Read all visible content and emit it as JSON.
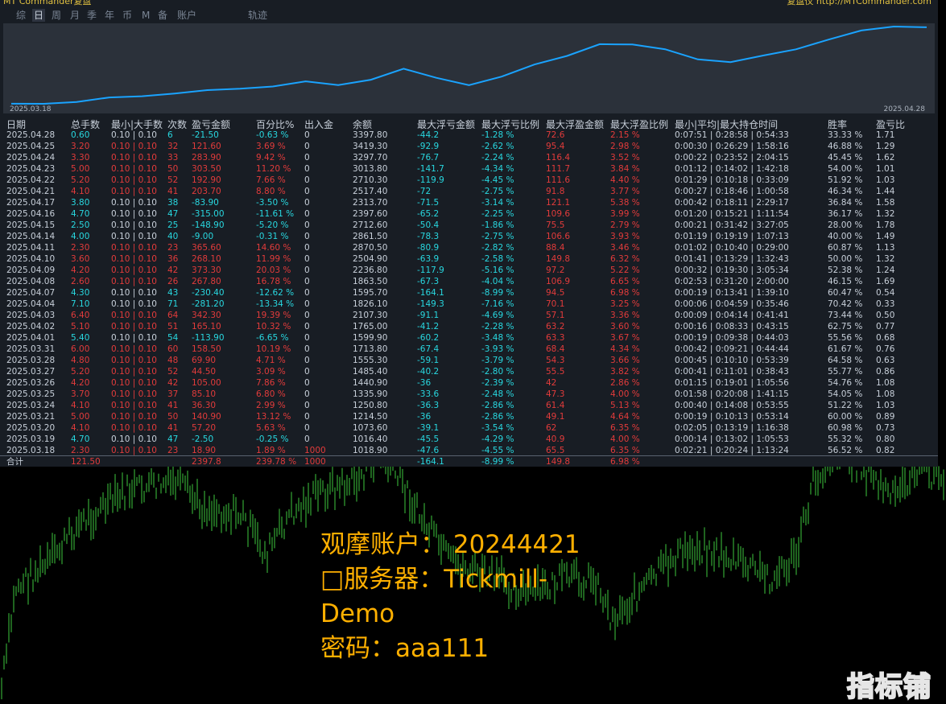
{
  "app": {
    "title_left": "MT Commander复盘",
    "title_right": "复盘仪 http://MTCommander.com"
  },
  "tabs": [
    "综",
    "日",
    "周",
    "月",
    "季",
    "年",
    "币",
    "M",
    "备",
    "账户",
    "轨迹"
  ],
  "active_tab": "日",
  "equity_chart": {
    "start_date": "2025.03.18",
    "end_date": "2025.04.28",
    "line_color": "#1aa3ff",
    "values": [
      1018.9,
      1016.4,
      1073.6,
      1214.5,
      1250.8,
      1335.9,
      1440.9,
      1485.4,
      1555.3,
      1713.8,
      1599.9,
      1765.0,
      2107.3,
      1826.1,
      1595.7,
      1863.5,
      2236.8,
      2504.9,
      2870.5,
      2861.5,
      2712.6,
      2397.6,
      2313.7,
      2517.4,
      2710.3,
      3013.8,
      3297.7,
      3419.3,
      3397.8
    ]
  },
  "table": {
    "headers": [
      "日期",
      "总手数",
      "最小|大手数",
      "次数",
      "盈亏金额",
      "百分比%",
      "出入金",
      "余额",
      "最大浮亏金额",
      "最大浮亏比例",
      "最大浮盈金额",
      "最大浮盈比例",
      "最小|平均|最大持仓时间",
      "胜率",
      "盈亏比"
    ],
    "rows": [
      [
        "2025.04.28",
        "0.60",
        "0.10 | 0.10",
        "6",
        "-21.50",
        "-0.63 %",
        "0",
        "3397.80",
        "-44.2",
        "-1.28 %",
        "72.6",
        "2.15 %",
        "0:07:51 | 0:28:58 | 0:54:33",
        "33.33 %",
        "1.71"
      ],
      [
        "2025.04.25",
        "3.20",
        "0.10 | 0.10",
        "32",
        "121.60",
        "3.69 %",
        "0",
        "3419.30",
        "-92.9",
        "-2.62 %",
        "95.4",
        "2.98 %",
        "0:00:30 | 0:26:29 | 1:58:16",
        "46.88 %",
        "1.29"
      ],
      [
        "2025.04.24",
        "3.30",
        "0.10 | 0.10",
        "33",
        "283.90",
        "9.42 %",
        "0",
        "3297.70",
        "-76.7",
        "-2.24 %",
        "116.4",
        "3.52 %",
        "0:00:22 | 0:23:52 | 2:04:15",
        "45.45 %",
        "1.62"
      ],
      [
        "2025.04.23",
        "5.00",
        "0.10 | 0.10",
        "50",
        "303.50",
        "11.20 %",
        "0",
        "3013.80",
        "-141.7",
        "-4.34 %",
        "111.7",
        "3.84 %",
        "0:01:12 | 0:14:02 | 1:42:18",
        "54.00 %",
        "1.01"
      ],
      [
        "2025.04.22",
        "5.20",
        "0.10 | 0.10",
        "52",
        "192.90",
        "7.66 %",
        "0",
        "2710.30",
        "-119.9",
        "-4.45 %",
        "111.6",
        "4.40 %",
        "0:01:29 | 0:10:18 | 0:33:09",
        "51.92 %",
        "1.03"
      ],
      [
        "2025.04.21",
        "4.10",
        "0.10 | 0.10",
        "41",
        "203.70",
        "8.80 %",
        "0",
        "2517.40",
        "-72",
        "-2.75 %",
        "91.8",
        "3.77 %",
        "0:00:27 | 0:18:46 | 1:00:58",
        "46.34 %",
        "1.44"
      ],
      [
        "2025.04.17",
        "3.80",
        "0.10 | 0.10",
        "38",
        "-83.90",
        "-3.50 %",
        "0",
        "2313.70",
        "-71.5",
        "-3.14 %",
        "121.1",
        "5.38 %",
        "0:00:42 | 0:18:11 | 2:29:17",
        "36.84 %",
        "1.58"
      ],
      [
        "2025.04.16",
        "4.70",
        "0.10 | 0.10",
        "47",
        "-315.00",
        "-11.61 %",
        "0",
        "2397.60",
        "-65.2",
        "-2.25 %",
        "109.6",
        "3.99 %",
        "0:01:20 | 0:15:21 | 1:11:54",
        "36.17 %",
        "1.32"
      ],
      [
        "2025.04.15",
        "2.50",
        "0.10 | 0.10",
        "25",
        "-148.90",
        "-5.20 %",
        "0",
        "2712.60",
        "-50.4",
        "-1.86 %",
        "75.5",
        "2.79 %",
        "0:00:21 | 0:31:42 | 3:27:05",
        "28.00 %",
        "1.78"
      ],
      [
        "2025.04.14",
        "4.00",
        "0.10 | 0.10",
        "40",
        "-9.00",
        "-0.31 %",
        "0",
        "2861.50",
        "-78.3",
        "-2.75 %",
        "106.6",
        "3.93 %",
        "0:01:19 | 0:19:19 | 1:07:13",
        "40.00 %",
        "1.49"
      ],
      [
        "2025.04.11",
        "2.30",
        "0.10 | 0.10",
        "23",
        "365.60",
        "14.60 %",
        "0",
        "2870.50",
        "-80.9",
        "-2.82 %",
        "88.4",
        "3.46 %",
        "0:01:02 | 0:10:40 | 0:29:00",
        "60.87 %",
        "1.13"
      ],
      [
        "2025.04.10",
        "3.60",
        "0.10 | 0.10",
        "36",
        "268.10",
        "11.99 %",
        "0",
        "2504.90",
        "-63.9",
        "-2.58 %",
        "149.8",
        "6.32 %",
        "0:01:41 | 0:13:29 | 1:32:43",
        "50.00 %",
        "1.32"
      ],
      [
        "2025.04.09",
        "4.20",
        "0.10 | 0.10",
        "42",
        "373.30",
        "20.03 %",
        "0",
        "2236.80",
        "-117.9",
        "-5.16 %",
        "97.2",
        "5.22 %",
        "0:00:32 | 0:19:30 | 3:05:34",
        "52.38 %",
        "1.24"
      ],
      [
        "2025.04.08",
        "2.60",
        "0.10 | 0.10",
        "26",
        "267.80",
        "16.78 %",
        "0",
        "1863.50",
        "-67.3",
        "-4.04 %",
        "106.9",
        "6.65 %",
        "0:02:53 | 0:31:20 | 2:00:00",
        "46.15 %",
        "1.69"
      ],
      [
        "2025.04.07",
        "4.30",
        "0.10 | 0.10",
        "43",
        "-230.40",
        "-12.62 %",
        "0",
        "1595.70",
        "-164.1",
        "-8.99 %",
        "94.5",
        "6.98 %",
        "0:00:19 | 0:13:41 | 1:39:10",
        "60.47 %",
        "0.54"
      ],
      [
        "2025.04.04",
        "7.10",
        "0.10 | 0.10",
        "71",
        "-281.20",
        "-13.34 %",
        "0",
        "1826.10",
        "-149.3",
        "-7.16 %",
        "70.1",
        "3.25 %",
        "0:00:06 | 0:04:59 | 0:35:46",
        "70.42 %",
        "0.33"
      ],
      [
        "2025.04.03",
        "6.40",
        "0.10 | 0.10",
        "64",
        "342.30",
        "19.39 %",
        "0",
        "2107.30",
        "-91.1",
        "-4.69 %",
        "57.1",
        "3.36 %",
        "0:00:09 | 0:04:14 | 0:41:41",
        "73.44 %",
        "0.50"
      ],
      [
        "2025.04.02",
        "5.10",
        "0.10 | 0.10",
        "51",
        "165.10",
        "10.32 %",
        "0",
        "1765.00",
        "-41.2",
        "-2.28 %",
        "63.2",
        "3.60 %",
        "0:00:16 | 0:08:33 | 0:43:15",
        "62.75 %",
        "0.77"
      ],
      [
        "2025.04.01",
        "5.40",
        "0.10 | 0.10",
        "54",
        "-113.90",
        "-6.65 %",
        "0",
        "1599.90",
        "-60.2",
        "-3.48 %",
        "63.3",
        "3.67 %",
        "0:00:19 | 0:09:38 | 0:44:03",
        "55.56 %",
        "0.68"
      ],
      [
        "2025.03.31",
        "6.00",
        "0.10 | 0.10",
        "60",
        "158.50",
        "10.19 %",
        "0",
        "1713.80",
        "-67.4",
        "-3.93 %",
        "68.4",
        "4.34 %",
        "0:00:42 | 0:09:21 | 0:44:44",
        "61.67 %",
        "0.76"
      ],
      [
        "2025.03.28",
        "4.80",
        "0.10 | 0.10",
        "48",
        "69.90",
        "4.71 %",
        "0",
        "1555.30",
        "-59.1",
        "-3.79 %",
        "54.3",
        "3.66 %",
        "0:00:45 | 0:10:10 | 0:53:39",
        "64.58 %",
        "0.63"
      ],
      [
        "2025.03.27",
        "5.20",
        "0.10 | 0.10",
        "52",
        "44.50",
        "3.09 %",
        "0",
        "1485.40",
        "-40.2",
        "-2.80 %",
        "55.5",
        "3.82 %",
        "0:00:41 | 0:11:01 | 0:38:43",
        "55.77 %",
        "0.86"
      ],
      [
        "2025.03.26",
        "4.20",
        "0.10 | 0.10",
        "42",
        "105.00",
        "7.86 %",
        "0",
        "1440.90",
        "-36",
        "-2.39 %",
        "42",
        "2.86 %",
        "0:01:15 | 0:19:01 | 1:05:56",
        "54.76 %",
        "1.08"
      ],
      [
        "2025.03.25",
        "3.70",
        "0.10 | 0.10",
        "37",
        "85.10",
        "6.80 %",
        "0",
        "1335.90",
        "-33.6",
        "-2.48 %",
        "47.3",
        "4.00 %",
        "0:01:58 | 0:20:08 | 1:41:15",
        "54.05 %",
        "1.08"
      ],
      [
        "2025.03.24",
        "4.10",
        "0.10 | 0.10",
        "41",
        "36.30",
        "2.99 %",
        "0",
        "1250.80",
        "-36.3",
        "-2.86 %",
        "61.4",
        "5.13 %",
        "0:00:40 | 0:14:08 | 0:53:55",
        "51.22 %",
        "1.03"
      ],
      [
        "2025.03.21",
        "5.00",
        "0.10 | 0.10",
        "50",
        "140.90",
        "13.12 %",
        "0",
        "1214.50",
        "-36",
        "-2.86 %",
        "49.1",
        "4.64 %",
        "0:00:19 | 0:10:13 | 0:53:14",
        "60.00 %",
        "0.89"
      ],
      [
        "2025.03.20",
        "4.10",
        "0.10 | 0.10",
        "41",
        "57.20",
        "5.63 %",
        "0",
        "1073.60",
        "-39.1",
        "-3.54 %",
        "62",
        "6.35 %",
        "0:02:05 | 0:13:19 | 1:16:38",
        "60.98 %",
        "0.73"
      ],
      [
        "2025.03.19",
        "4.70",
        "0.10 | 0.10",
        "47",
        "-2.50",
        "-0.25 %",
        "0",
        "1016.40",
        "-45.5",
        "-4.29 %",
        "40.9",
        "4.00 %",
        "0:00:14 | 0:13:02 | 1:05:53",
        "55.32 %",
        "0.80"
      ],
      [
        "2025.03.18",
        "2.30",
        "0.10 | 0.10",
        "23",
        "18.90",
        "1.89 %",
        "1000",
        "1018.90",
        "-47.6",
        "-4.55 %",
        "65.5",
        "6.35 %",
        "0:02:21 | 0:20:24 | 1:13:24",
        "56.52 %",
        "0.82"
      ]
    ],
    "total": [
      "合计",
      "121.50",
      "",
      "",
      "2397.8",
      "239.78 %",
      "1000",
      "",
      "-164.1",
      "-8.99 %",
      "149.8",
      "6.98 %",
      "",
      "",
      ""
    ]
  },
  "overlay": {
    "line1": "观摩账户：  20244421",
    "line2": "□服务器：Tickmill-",
    "line3": "Demo",
    "line4": "密码：aaa111"
  },
  "watermark": "指标铺",
  "colors": {
    "profit": "#e23b3b",
    "loss": "#28d8e0",
    "text": "#c8d0da",
    "overlay": "#ffb000",
    "candle": "#3ec83e",
    "panel": "#181d24"
  }
}
